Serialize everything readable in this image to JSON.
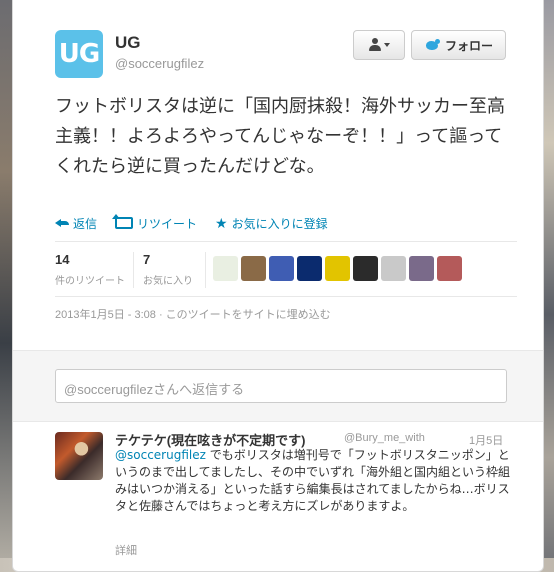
{
  "profile": {
    "avatar_text": "UG",
    "avatar_color": "#5bc1e9",
    "name": "UG",
    "handle": "@soccerugfilez"
  },
  "buttons": {
    "follow_label": "フォロー"
  },
  "tweet": {
    "text": "フットボリスタは逆に「国内厨抹殺！海外サッカー至高主義！！よろよろやってんじゃなーぞ！！」って謳ってくれたら逆に買ったんだけどな。",
    "timestamp": "2013年1月5日 - 3:08 · このツイートをサイトに埋め込む"
  },
  "actions": {
    "reply": "返信",
    "retweet": "リツイート",
    "favorite": "お気に入りに登録"
  },
  "stats": {
    "retweets_count": "14",
    "retweets_label": "件のリツイート",
    "favorites_count": "7",
    "favorites_label": "お気に入り"
  },
  "facepile": {
    "colors": [
      "#e9efe2",
      "#8a6a47",
      "#3f5db3",
      "#0b2b6e",
      "#e2c400",
      "#2b2b2b",
      "#c9c9c9",
      "#7a6a8a",
      "#b45a5a"
    ]
  },
  "reply_box": {
    "placeholder": "@soccerugfilezさんへ返信する"
  },
  "reply_tweet": {
    "name": "テケテケ(現在呟きが不定期です)",
    "handle": "@Bury_me_with",
    "time": "1月5日",
    "mention": "@soccerugfilez",
    "text": " でもボリスタは増刊号で「フットボリスタニッポン」というのまで出してましたし、その中でいずれ「海外組と国内組という枠組みはいつか消える」といった話すら編集長はされてましたからね…ボリスタと佐藤さんではちょっと考え方にズレがありますよ。",
    "detail": "詳細"
  },
  "colors": {
    "link": "#0084b4",
    "muted": "#999999"
  }
}
